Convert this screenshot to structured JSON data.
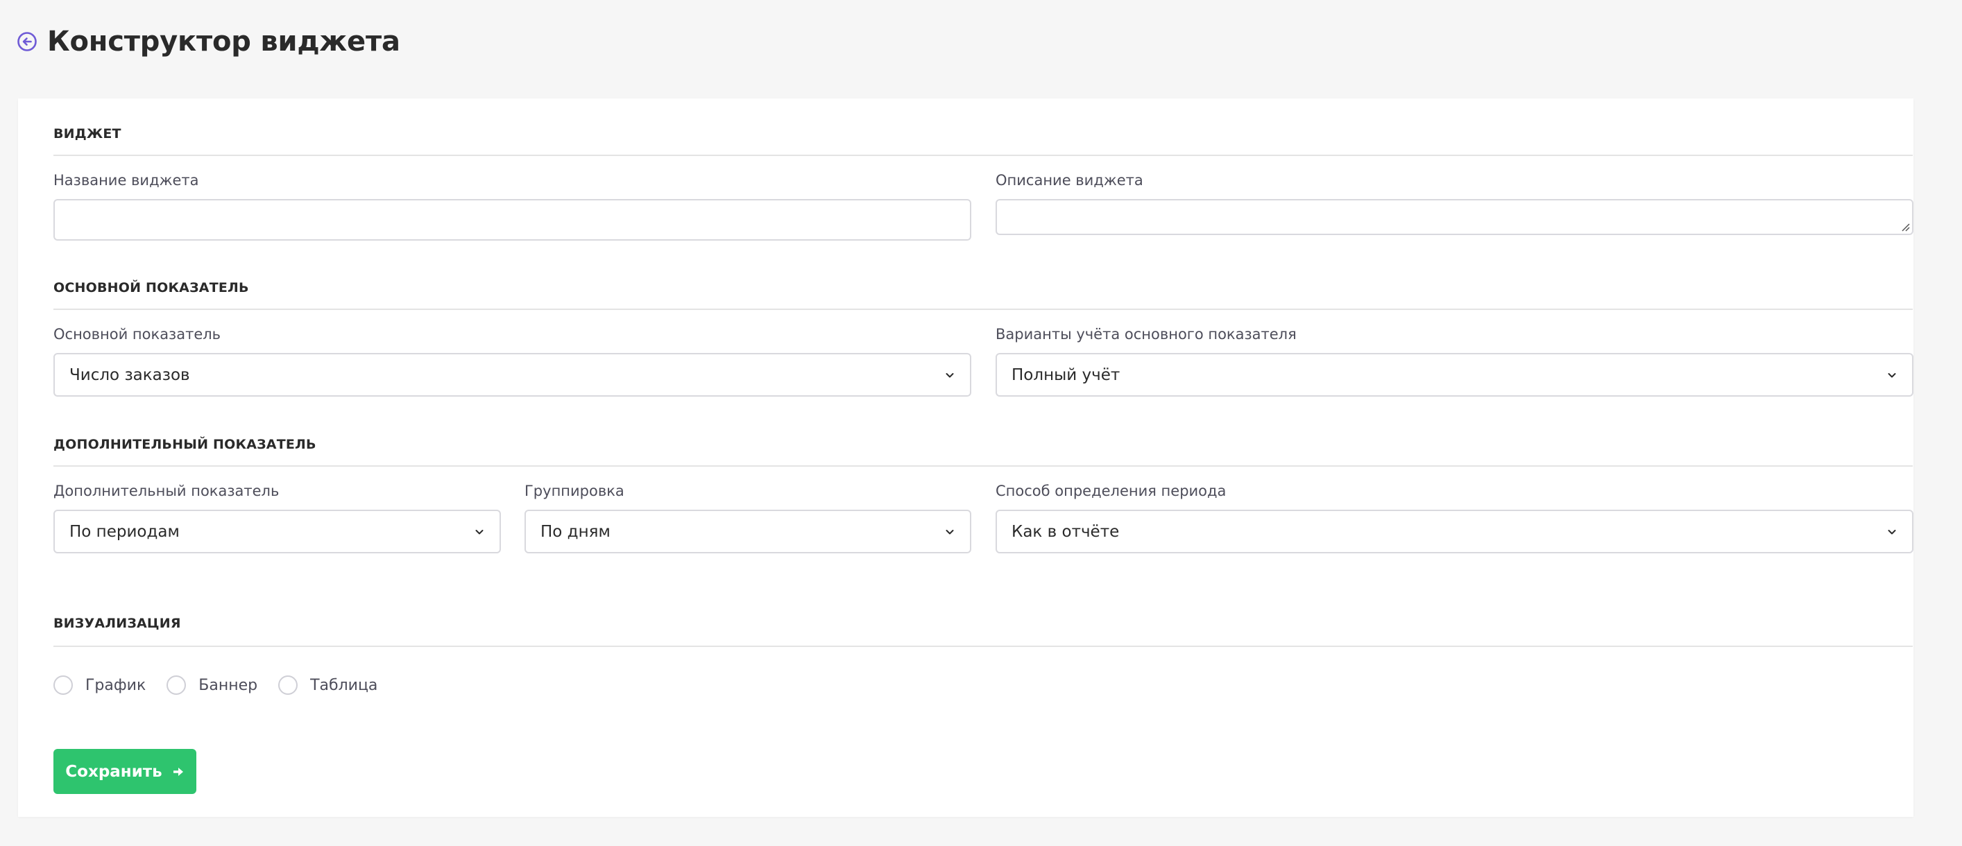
{
  "header": {
    "title": "Конструктор виджета",
    "back_icon": "arrow-left-circle-icon"
  },
  "colors": {
    "accent": "#6f5bd6",
    "save_button": "#2ec46e",
    "border": "#d9d9de"
  },
  "sections": {
    "widget": {
      "title": "ВИДЖЕТ",
      "name_label": "Название виджета",
      "name_value": "",
      "description_label": "Описание виджета",
      "description_value": ""
    },
    "primary": {
      "title": "ОСНОВНОЙ ПОКАЗАТЕЛЬ",
      "metric_label": "Основной показатель",
      "metric_value": "Число заказов",
      "variant_label": "Варианты учёта основного показателя",
      "variant_value": "Полный учёт"
    },
    "secondary": {
      "title": "ДОПОЛНИТЕЛЬНЫЙ ПОКАЗАТЕЛЬ",
      "metric_label": "Дополнительный показатель",
      "metric_value": "По периодам",
      "grouping_label": "Группировка",
      "grouping_value": "По дням",
      "period_label": "Способ определения периода",
      "period_value": "Как в отчёте"
    },
    "visualization": {
      "title": "ВИЗУАЛИЗАЦИЯ",
      "options": [
        {
          "label": "График",
          "selected": false
        },
        {
          "label": "Баннер",
          "selected": false
        },
        {
          "label": "Таблица",
          "selected": false
        }
      ]
    }
  },
  "save_button": {
    "label": "Сохранить",
    "icon": "arrow-right-icon"
  }
}
